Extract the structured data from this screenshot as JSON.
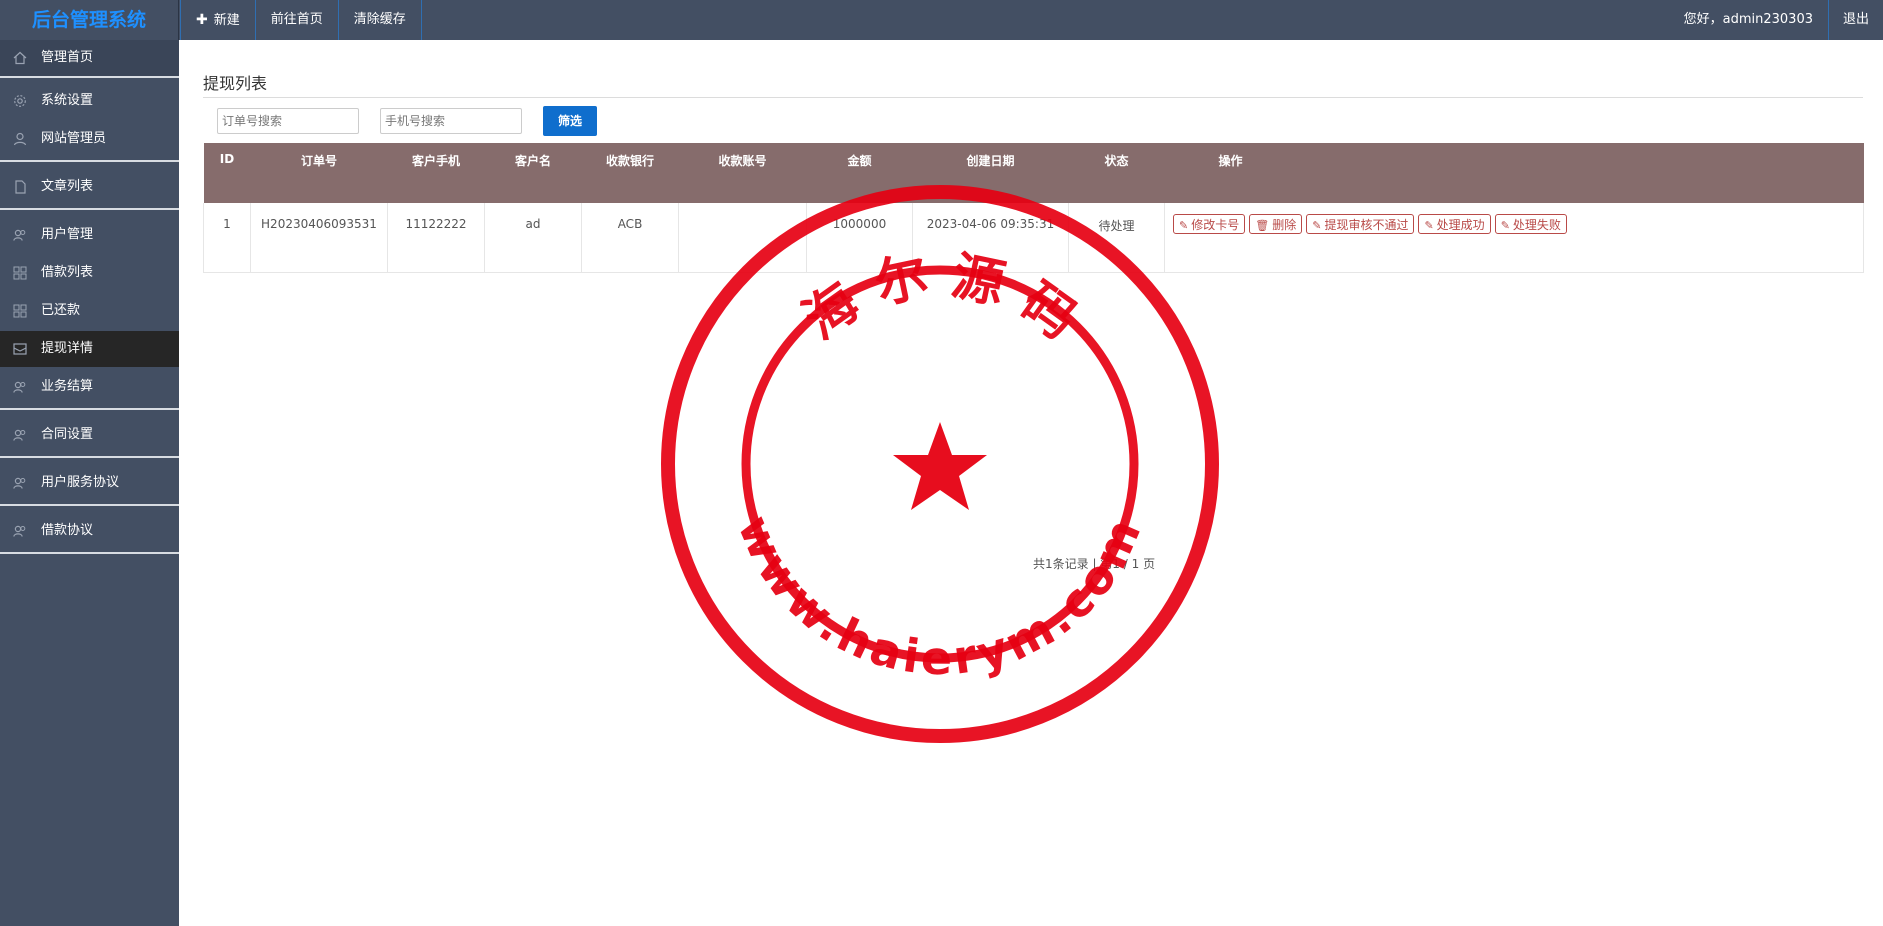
{
  "header": {
    "brand": "后台管理系统",
    "nav": [
      {
        "label": "新建",
        "icon": "plus-icon"
      },
      {
        "label": "前往首页"
      },
      {
        "label": "清除缓存"
      }
    ],
    "greeting": "您好，admin230303",
    "logout": "退出"
  },
  "sidebar": {
    "items": [
      {
        "label": "管理首页",
        "icon": "home-icon"
      },
      {
        "label": "系统设置",
        "icon": "gear-icon"
      },
      {
        "label": "网站管理员",
        "icon": "user-icon"
      },
      {
        "label": "文章列表",
        "icon": "document-icon"
      },
      {
        "label": "用户管理",
        "icon": "users-icon"
      },
      {
        "label": "借款列表",
        "icon": "grid-icon"
      },
      {
        "label": "已还款",
        "icon": "grid-icon"
      },
      {
        "label": "提现详情",
        "icon": "inbox-icon"
      },
      {
        "label": "业务结算",
        "icon": "users-icon"
      },
      {
        "label": "合同设置",
        "icon": "users-icon"
      },
      {
        "label": "用户服务协议",
        "icon": "users-icon"
      },
      {
        "label": "借款协议",
        "icon": "users-icon"
      }
    ],
    "active_label": "提现详情"
  },
  "main": {
    "title": "提现列表",
    "filters": {
      "order_placeholder": "订单号搜索",
      "phone_placeholder": "手机号搜索",
      "button": "筛选"
    },
    "table": {
      "columns": [
        "ID",
        "订单号",
        "客户手机",
        "客户名",
        "收款银行",
        "收款账号",
        "金额",
        "创建日期",
        "状态",
        "操作"
      ],
      "rows": [
        {
          "id": "1",
          "order_no": "H20230406093531",
          "phone": "11122222",
          "name": "ad",
          "bank": "ACB",
          "account": "",
          "amount": "1000000",
          "created": "2023-04-06 09:35:31",
          "status": "待处理",
          "actions": [
            "修改卡号",
            "删除",
            "提现审核不通过",
            "处理成功",
            "处理失败"
          ]
        }
      ]
    },
    "pager": "共1条记录 | 第1 / 1 页"
  },
  "watermark": {
    "top_text": "海 尔 源 码",
    "bottom_text": "www.haierym.com",
    "color": "#e60012"
  }
}
